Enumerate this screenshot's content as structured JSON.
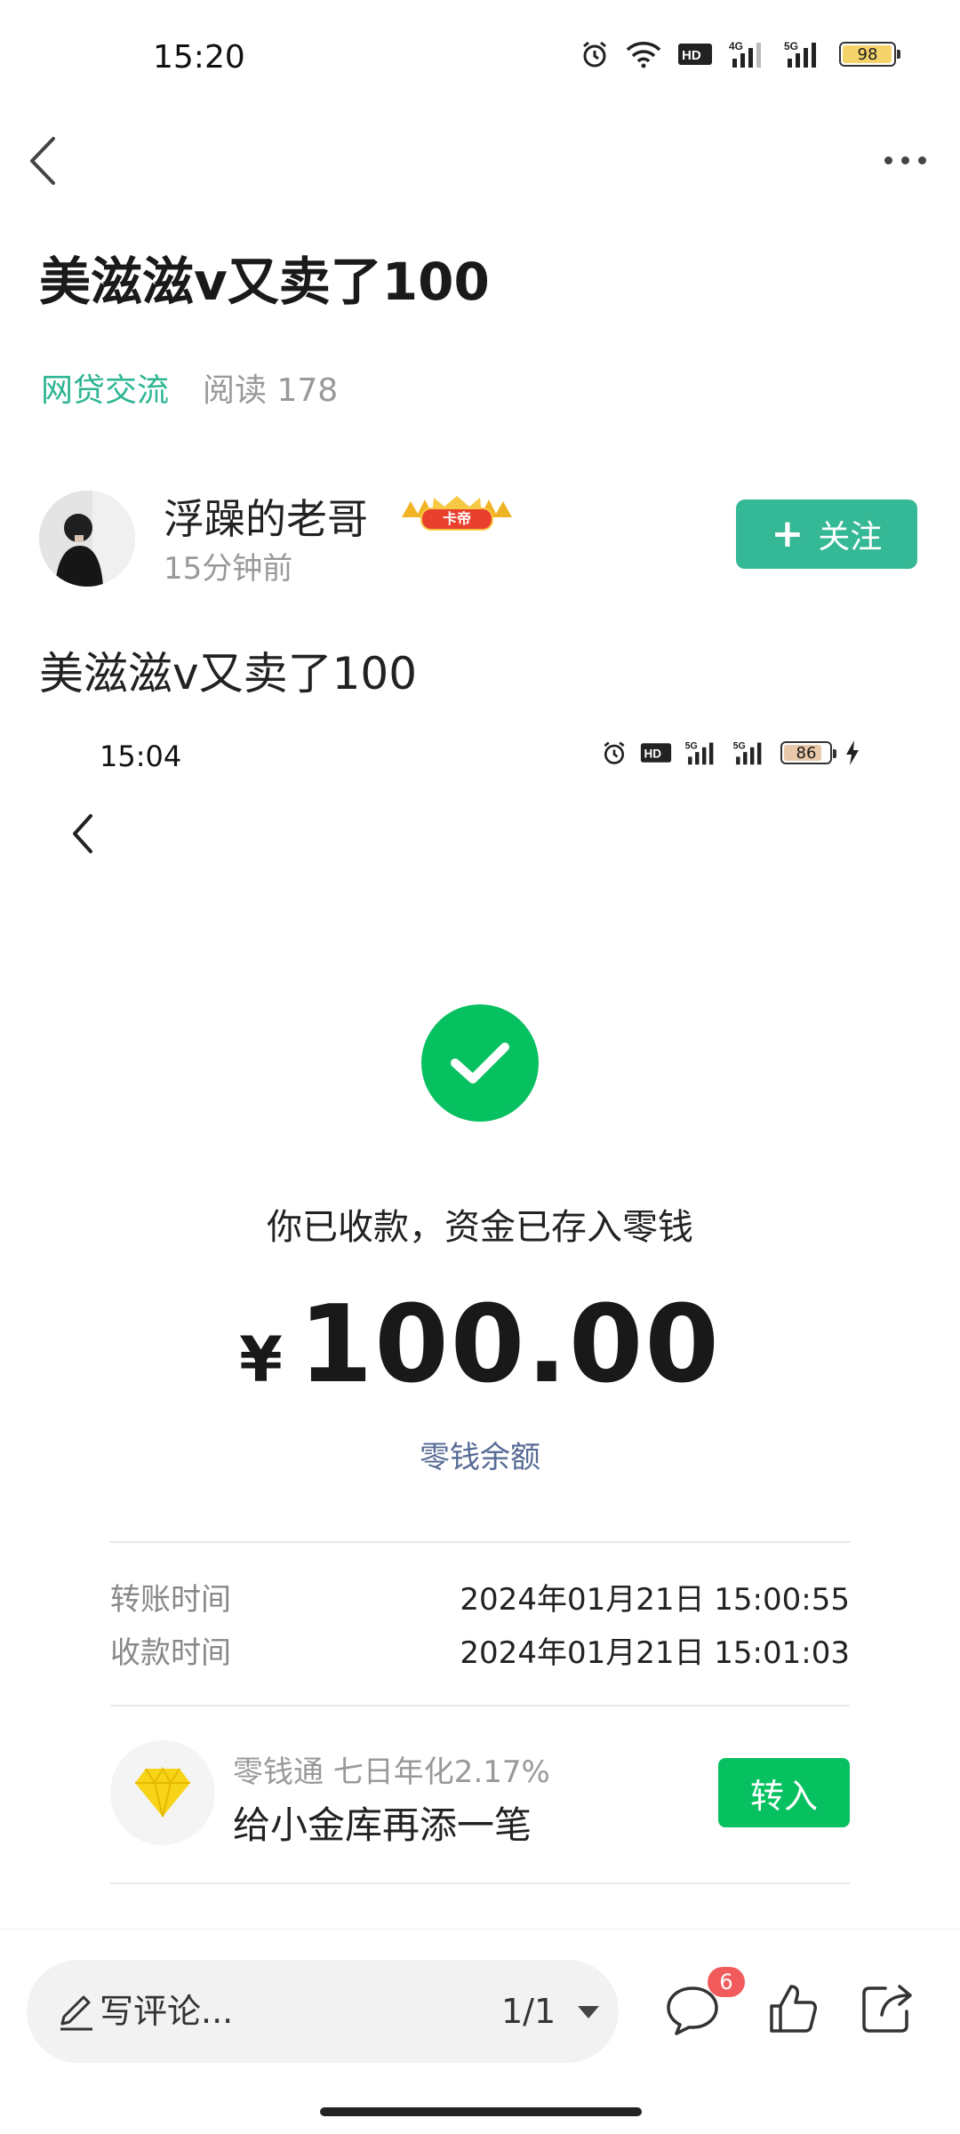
{
  "status_bar": {
    "time": "15:20",
    "battery": "98"
  },
  "post": {
    "title": "美滋滋v又卖了100",
    "tag": "网贷交流",
    "reads": "阅读 178",
    "author": {
      "name": "浮躁的老哥",
      "badge": "卡帝",
      "time_ago": "15分钟前"
    },
    "follow_label": "关注",
    "follow_icon": "plus-icon",
    "body": "美滋滋v又卖了100"
  },
  "screenshot": {
    "status_time": "15:04",
    "battery": "86",
    "message": "你已收款，资金已存入零钱",
    "currency": "¥",
    "amount": "100.00",
    "balance_link": "零钱余额",
    "rows": [
      {
        "label": "转账时间",
        "value": "2024年01月21日 15:00:55"
      },
      {
        "label": "收款时间",
        "value": "2024年01月21日 15:01:03"
      }
    ],
    "promo": {
      "subtitle": "零钱通 七日年化2.17%",
      "title": "给小金库再添一笔",
      "button": "转入"
    }
  },
  "bottom_bar": {
    "comment_placeholder": "写评论...",
    "page_indicator": "1/1",
    "comment_count": "6"
  },
  "colors": {
    "accent": "#34b895",
    "wechat_green": "#07c160",
    "link_blue": "#576b95",
    "badge_red": "#f25b5b"
  }
}
